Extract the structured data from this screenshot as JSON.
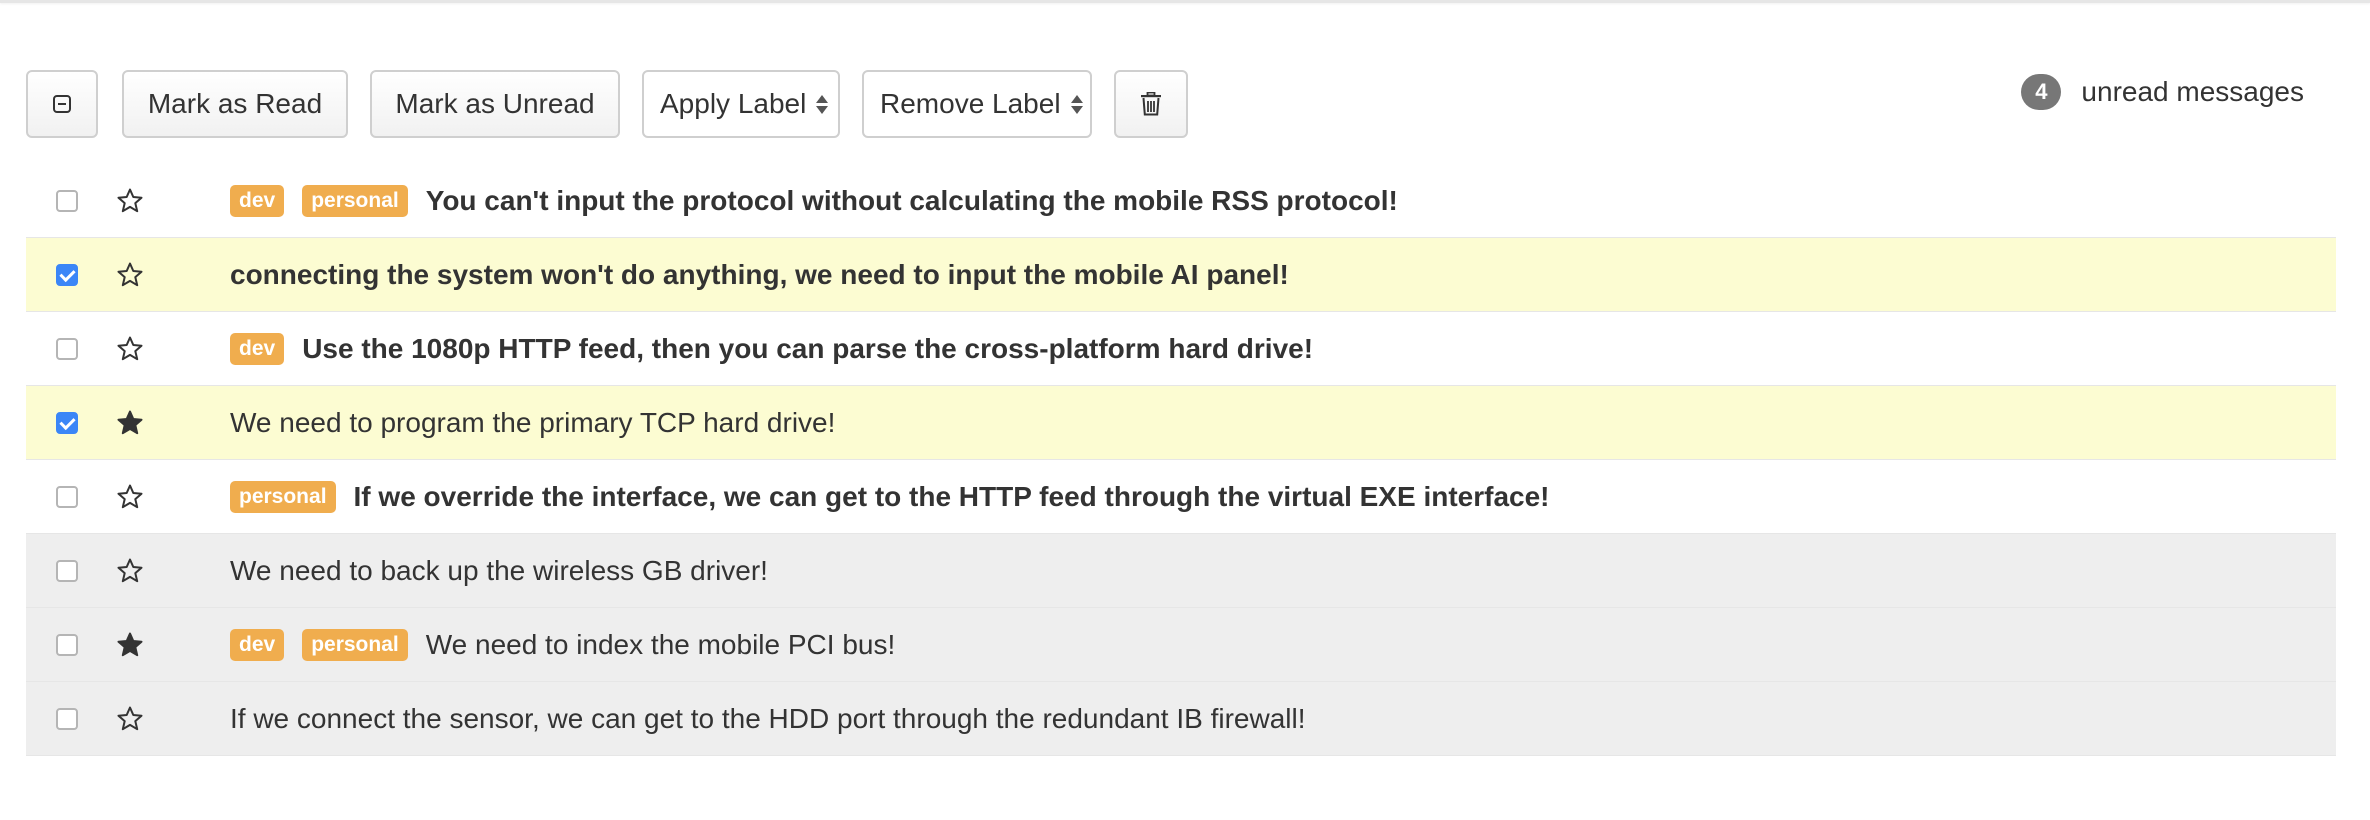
{
  "toolbar": {
    "select_toggle_icon": "minus-square-icon",
    "mark_read_label": "Mark as Read",
    "mark_unread_label": "Mark as Unread",
    "apply_label_select": "Apply Label",
    "remove_label_select": "Remove Label",
    "delete_icon": "trash-icon"
  },
  "unread": {
    "count": "4",
    "text": "unread messages",
    "badge_color": "#777777"
  },
  "colors": {
    "label_bg": "#f0ad4e",
    "selected_row_bg": "#fcfcd2",
    "read_row_bg": "#eeeeee",
    "checkbox_checked": "#3b86f7"
  },
  "messages": [
    {
      "checked": false,
      "starred": false,
      "read": false,
      "labels": [
        "dev",
        "personal"
      ],
      "subject": "You can't input the protocol without calculating the mobile RSS protocol!"
    },
    {
      "checked": true,
      "starred": false,
      "read": false,
      "labels": [],
      "subject": "connecting the system won't do anything, we need to input the mobile AI panel!"
    },
    {
      "checked": false,
      "starred": false,
      "read": false,
      "labels": [
        "dev"
      ],
      "subject": "Use the 1080p HTTP feed, then you can parse the cross-platform hard drive!"
    },
    {
      "checked": true,
      "starred": true,
      "read": true,
      "labels": [],
      "subject": "We need to program the primary TCP hard drive!"
    },
    {
      "checked": false,
      "starred": false,
      "read": false,
      "labels": [
        "personal"
      ],
      "subject": "If we override the interface, we can get to the HTTP feed through the virtual EXE interface!"
    },
    {
      "checked": false,
      "starred": false,
      "read": true,
      "labels": [],
      "subject": "We need to back up the wireless GB driver!"
    },
    {
      "checked": false,
      "starred": true,
      "read": true,
      "labels": [
        "dev",
        "personal"
      ],
      "subject": "We need to index the mobile PCI bus!"
    },
    {
      "checked": false,
      "starred": false,
      "read": true,
      "labels": [],
      "subject": "If we connect the sensor, we can get to the HDD port through the redundant IB firewall!"
    }
  ]
}
